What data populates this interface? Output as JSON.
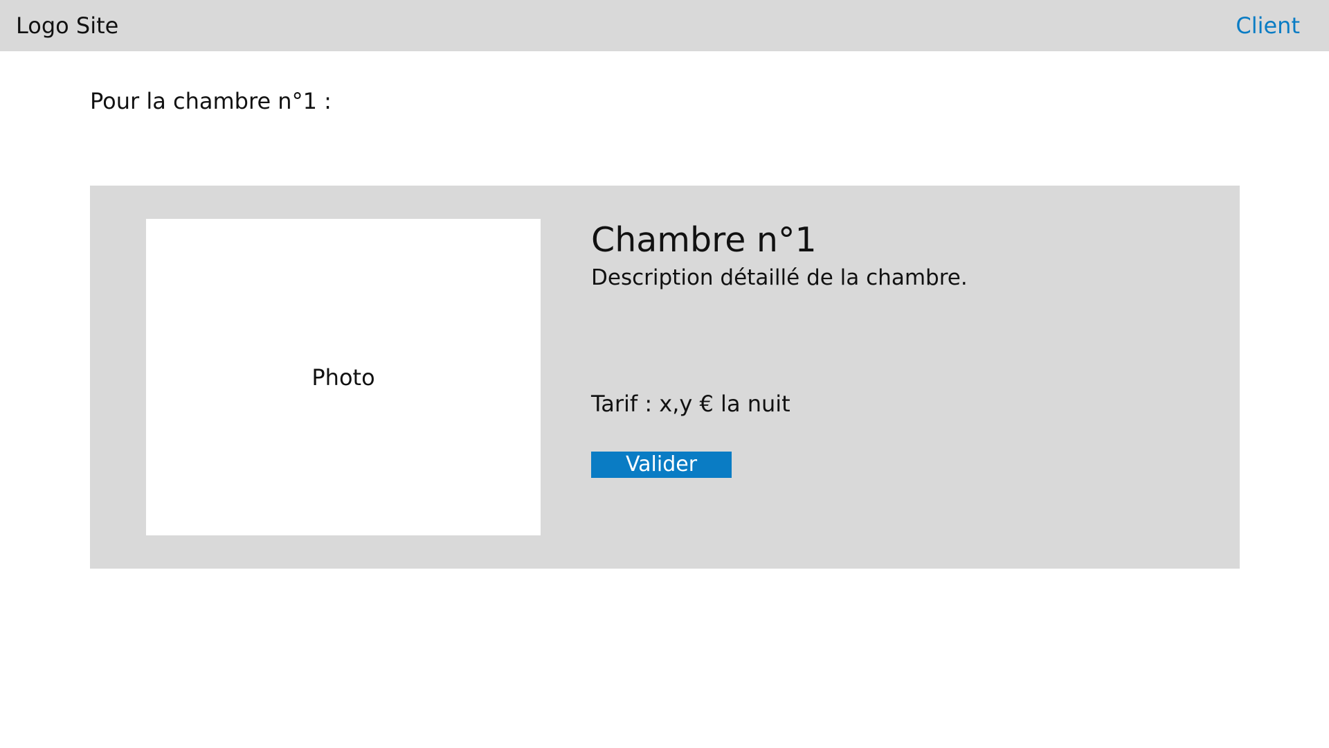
{
  "header": {
    "logo_text": "Logo Site",
    "client_link": "Client"
  },
  "intro": {
    "text": "Pour la chambre n°1 :"
  },
  "room": {
    "photo_placeholder": "Photo",
    "title": "Chambre n°1",
    "description": "Description détaillé de la chambre.",
    "price": "Tarif : x,y € la nuit",
    "validate_label": "Valider"
  },
  "colors": {
    "header_background": "#d9d9d9",
    "card_background": "#d9d9d9",
    "accent": "#0a7cc4",
    "text": "#111111"
  }
}
